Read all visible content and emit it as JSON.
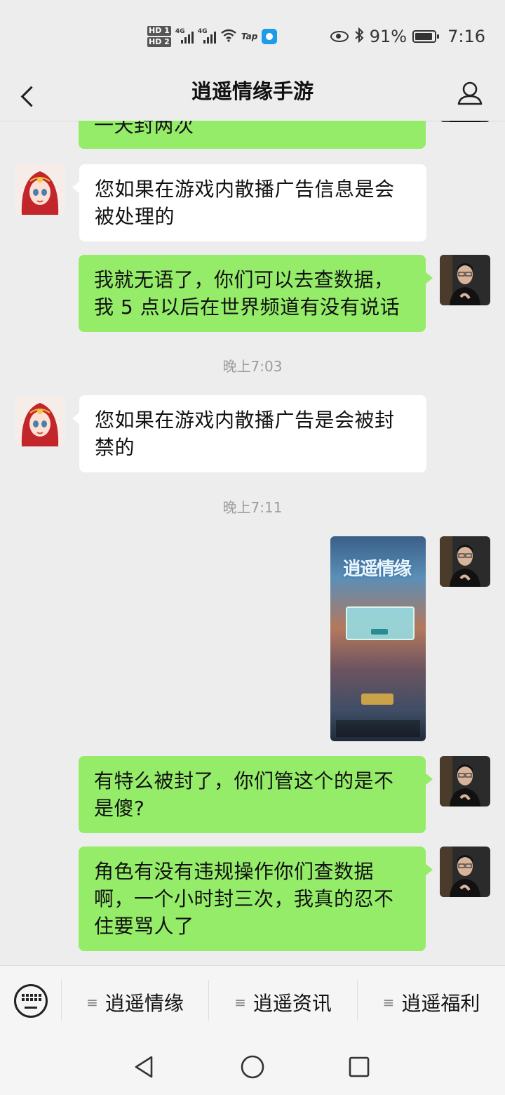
{
  "status_bar": {
    "hd_labels": [
      "HD 1",
      "HD 2"
    ],
    "network_1": "4G",
    "network_2": "4G",
    "tap_label": "Tap",
    "battery_percent": "91%",
    "time": "7:16",
    "icons": [
      "signal-icon",
      "wifi-icon",
      "tap-app-icon",
      "eye-icon",
      "bluetooth-icon",
      "battery-icon"
    ]
  },
  "header": {
    "title": "逍遥情缘手游",
    "back_icon": "chevron-left-icon",
    "profile_icon": "person-icon"
  },
  "messages": [
    {
      "sender": "self",
      "text": "一天封两次"
    },
    {
      "sender": "other",
      "text": "您如果在游戏内散播广告信息是会被处理的"
    },
    {
      "sender": "self",
      "text": "我就无语了，你们可以去查数据，我 5 点以后在世界频道有没有说话"
    },
    {
      "type": "time",
      "text": "晚上7:03"
    },
    {
      "sender": "other",
      "text": "您如果在游戏内散播广告是会被封禁的"
    },
    {
      "type": "time",
      "text": "晚上7:11"
    },
    {
      "sender": "self",
      "type": "image",
      "image_text": "逍遥情缘"
    },
    {
      "sender": "self",
      "text": "有特么被封了，你们管这个的是不是傻?"
    },
    {
      "sender": "self",
      "text": "角色有没有违规操作你们查数据啊，一个小时封三次，我真的忍不住要骂人了"
    }
  ],
  "bottom_menu": {
    "keyboard_icon": "keyboard-icon",
    "items": [
      "逍遥情缘",
      "逍遥资讯",
      "逍遥福利"
    ]
  },
  "system_nav": [
    "back-triangle-icon",
    "home-circle-icon",
    "recents-square-icon"
  ]
}
